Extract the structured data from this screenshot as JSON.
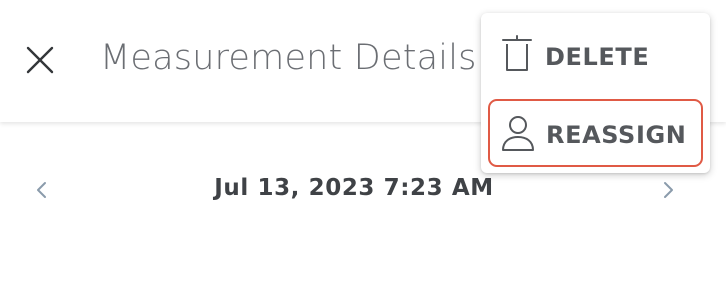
{
  "header": {
    "title": "Measurement Details",
    "close_icon": "close-icon"
  },
  "date_nav": {
    "date": "Jul 13, 2023 7:23 AM",
    "prev_icon": "chevron-left-icon",
    "next_icon": "chevron-right-icon"
  },
  "menu": {
    "items": [
      {
        "label": "DELETE",
        "icon": "trash-icon"
      },
      {
        "label": "REASSIGN",
        "icon": "user-icon",
        "highlighted": true
      }
    ],
    "highlight_color": "#e05a45"
  },
  "colors": {
    "title_text": "#6b6e73",
    "date_text": "#3f4246",
    "chevron": "#8a9bab"
  }
}
